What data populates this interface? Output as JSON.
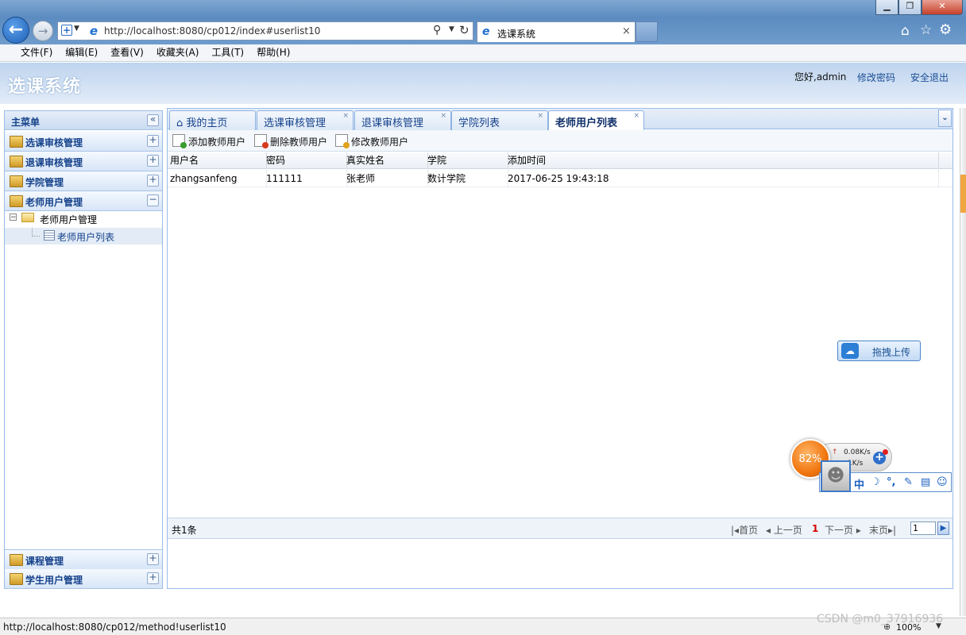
{
  "browser": {
    "address_url": "http://localhost:8080/cp012/index#userlist10",
    "tab_title": "选课系统",
    "tab_close": "×",
    "menubar": [
      "文件(F)",
      "编辑(E)",
      "查看(V)",
      "收藏夹(A)",
      "工具(T)",
      "帮助(H)"
    ]
  },
  "header": {
    "title": "选课系统",
    "greeting": "您好,admin",
    "change_password": "修改密码",
    "logout": "安全退出"
  },
  "sidebar": {
    "title": "主菜单",
    "collapse_glyph": "«",
    "expand_glyph": "+",
    "collapse_item_glyph": "−",
    "top_items": [
      "选课审核管理",
      "退课审核管理",
      "学院管理",
      "老师用户管理"
    ],
    "tree_root": "老师用户管理",
    "tree_leaf": "老师用户列表",
    "bottom_items": [
      "课程管理",
      "学生用户管理"
    ]
  },
  "tabs": [
    {
      "label": "我的主页",
      "closable": false
    },
    {
      "label": "选课审核管理",
      "closable": true
    },
    {
      "label": "退课审核管理",
      "closable": true
    },
    {
      "label": "学院列表",
      "closable": true
    },
    {
      "label": "老师用户列表",
      "closable": true,
      "active": true
    }
  ],
  "tab_close_glyph": "×",
  "tab_home_glyph": "⌂",
  "toolbar": {
    "add": "添加教师用户",
    "delete": "删除教师用户",
    "edit": "修改教师用户"
  },
  "table": {
    "columns": [
      "用户名",
      "密码",
      "真实姓名",
      "学院",
      "添加时间"
    ],
    "rows": [
      [
        "zhangsanfeng",
        "111111",
        "张老师",
        "数计学院",
        "2017-06-25 19:43:18"
      ]
    ]
  },
  "pager": {
    "total": "共1条",
    "first": "首页",
    "prev": "上一页",
    "current": "1",
    "next": "下一页",
    "last": "末页",
    "page_input": "1"
  },
  "upload_widget": {
    "label": "拖拽上传"
  },
  "speed_widget": {
    "percent": "82%",
    "upload_speed": "0.08K/s",
    "download_speed": "1K/s"
  },
  "ime_bar": {
    "items": [
      "中",
      "☽",
      "°,",
      "✎",
      "▤",
      "☺"
    ]
  },
  "statusbar": {
    "url": "http://localhost:8080/cp012/method!userlist10",
    "zoom": "100%",
    "watermark": "CSDN @m0_37916936"
  },
  "colors": {
    "accent": "#15428b",
    "panel_border": "#99bbe8",
    "pager_current": "#d40000"
  }
}
